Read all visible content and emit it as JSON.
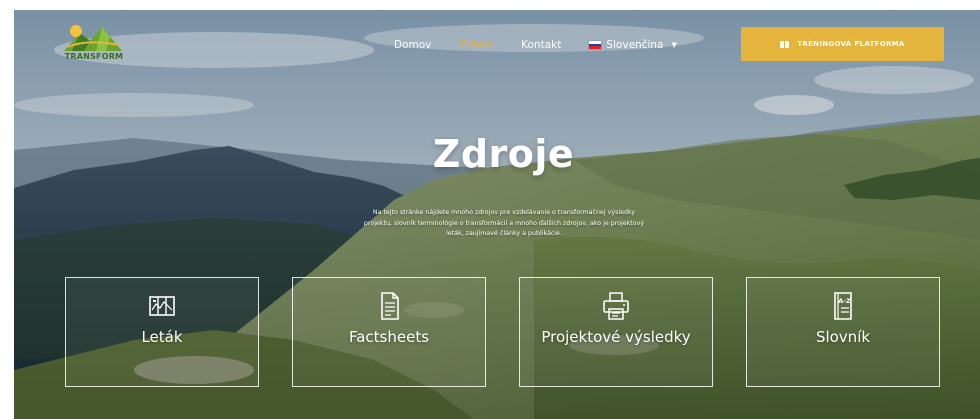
{
  "brand": {
    "logo_text": "TRANSFORM"
  },
  "nav": {
    "items": [
      {
        "label": "Domov"
      },
      {
        "label": "Zdroje",
        "active": true
      },
      {
        "label": "Kontakt"
      }
    ],
    "language": {
      "label": "Slovenčina",
      "flag_colors": [
        "#ffffff",
        "#0b4ea2",
        "#ee1c25"
      ]
    }
  },
  "cta": {
    "label": "TRÉNINGOVÁ PLATFORMA",
    "color": "#e5b43c"
  },
  "hero": {
    "title": "Zdroje",
    "description": "Na tejto stránke nájdete mnoho zdrojov pre vzdelávanie o transformačnej výsledky projektu, slovník terminológie o transformácií a mnoho ďalších zdrojov, ako je projektový leták, zaujímavé články a publikácie."
  },
  "cards": [
    {
      "label": "Leták",
      "icon": "map-icon"
    },
    {
      "label": "Factsheets",
      "icon": "document-icon"
    },
    {
      "label": "Projektové výsledky",
      "icon": "printer-icon"
    },
    {
      "label": "Slovník",
      "icon": "dictionary-icon"
    }
  ],
  "colors": {
    "accent": "#e5b43c",
    "nav_active": "#e4b241",
    "text": "#ffffff"
  }
}
